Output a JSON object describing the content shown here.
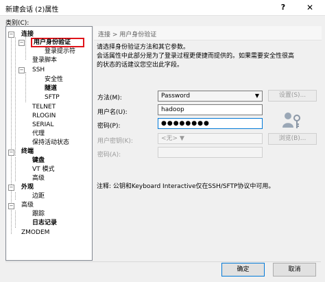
{
  "window": {
    "title": "新建会话 (2)属性",
    "help_glyph": "?",
    "close_glyph": "✕"
  },
  "category_label": "类别(C):",
  "tree": {
    "items": [
      {
        "label": "连接",
        "bold": true
      },
      {
        "label": "用户身份验证",
        "bold": true,
        "selected": true
      },
      {
        "label": "登录提示符"
      },
      {
        "label": "登录脚本"
      },
      {
        "label": "SSH"
      },
      {
        "label": "安全性"
      },
      {
        "label": "隧道",
        "bold": true
      },
      {
        "label": "SFTP"
      },
      {
        "label": "TELNET"
      },
      {
        "label": "RLOGIN"
      },
      {
        "label": "SERIAL"
      },
      {
        "label": "代理"
      },
      {
        "label": "保持活动状态"
      },
      {
        "label": "终端",
        "bold": true
      },
      {
        "label": "键盘",
        "bold": true
      },
      {
        "label": "VT 模式"
      },
      {
        "label": "高级"
      },
      {
        "label": "外观",
        "bold": true
      },
      {
        "label": "边距"
      },
      {
        "label": "高级"
      },
      {
        "label": "跟踪"
      },
      {
        "label": "日志记录",
        "bold": true
      },
      {
        "label": "ZMODEM"
      }
    ]
  },
  "header": {
    "breadcrumb": "连接 > 用户身份验证"
  },
  "description": {
    "line1": "请选择身份验证方法和其它参数。",
    "line2": "会话属性中此部分是为了登录过程更便捷而提供的。如果需要安全性很高",
    "line3": "的状态的话建议您空出此字段。"
  },
  "form": {
    "method_label": "方法(M):",
    "method_value": "Password",
    "settings_button": "设置(S)...",
    "username_label": "用户名(U):",
    "username_value": "hadoop",
    "password_label": "密码(P):",
    "password_value": "●●●●●●●●",
    "user_key_label": "用户密钥(K):",
    "user_key_value": "<无>",
    "browse_button": "浏览(B)...",
    "passphrase_label": "密码(A):"
  },
  "note": "注释: 公钥和Keyboard Interactive仅在SSH/SFTP协议中可用。",
  "footer": {
    "ok_button": "确定",
    "cancel_button": "取消"
  }
}
